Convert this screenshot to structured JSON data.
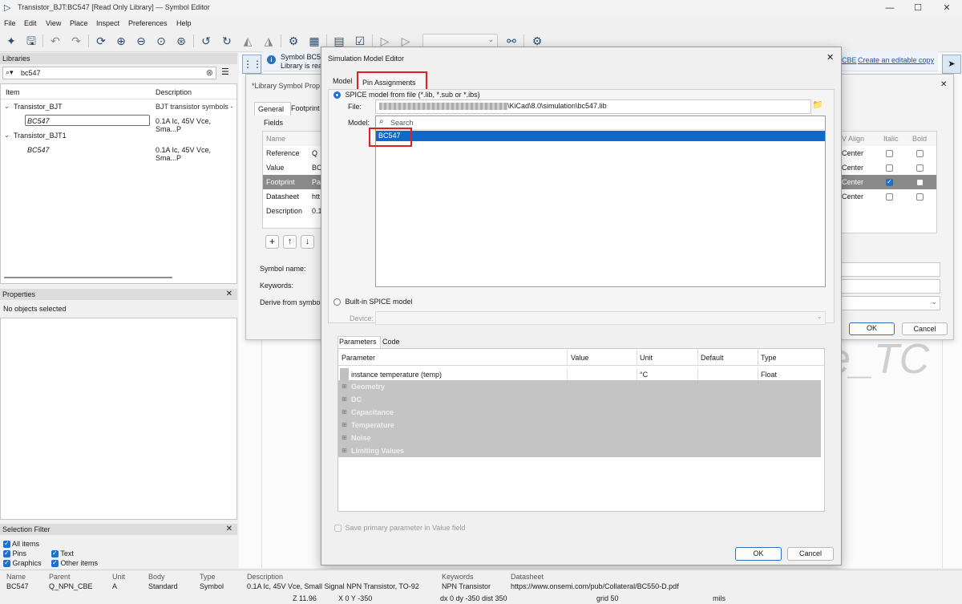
{
  "window": {
    "title": "Transistor_BJT:BC547 [Read Only Library] — Symbol Editor",
    "menu": [
      "File",
      "Edit",
      "View",
      "Place",
      "Inspect",
      "Preferences",
      "Help"
    ]
  },
  "libraries": {
    "header": "Libraries",
    "search_value": "bc547",
    "col_item": "Item",
    "col_description": "Description",
    "rows": [
      {
        "item": "Transistor_BJT",
        "description": "BJT transistor symbols -"
      },
      {
        "item": "BC547",
        "description": "0.1A Ic, 45V Vce, Sma...P"
      },
      {
        "item": "Transistor_BJT1",
        "description": ""
      },
      {
        "item": "BC547",
        "description": "0.1A Ic, 45V Vce, Sma...P"
      }
    ]
  },
  "properties": {
    "header": "Properties",
    "empty_text": "No objects selected"
  },
  "selection_filter": {
    "header": "Selection Filter",
    "items": [
      "All items",
      "Pins",
      "Text",
      "Graphics",
      "Other items"
    ]
  },
  "infobar": {
    "line1": "Symbol BC5",
    "line2": "Library is rea",
    "link1": "CBE",
    "link2": "Create an editable copy"
  },
  "lib_props": {
    "title": "*Library Symbol Prop",
    "tab_general": "General",
    "tab_footprint": "Footprint",
    "fields_label": "Fields",
    "rows": [
      {
        "name": "Name",
        "value": ""
      },
      {
        "name": "Reference",
        "value": "Q"
      },
      {
        "name": "Value",
        "value": "BC"
      },
      {
        "name": "Footprint",
        "value": "Pa"
      },
      {
        "name": "Datasheet",
        "value": "htt"
      },
      {
        "name": "Description",
        "value": "0.1"
      }
    ],
    "symbol_name_label": "Symbol name:",
    "keywords_label": "Keywords:",
    "derive_label": "Derive from symbo",
    "right_cols": [
      "V Align",
      "Italic",
      "Bold"
    ],
    "right_rows": [
      "Center",
      "Center",
      "Center",
      "Center"
    ],
    "ok": "OK",
    "cancel": "Cancel"
  },
  "sim_dialog": {
    "title": "Simulation Model Editor",
    "tab_model": "Model",
    "tab_pins": "Pin Assignments",
    "spice_file_radio": "SPICE model from file (*.lib, *.sub or *.ibs)",
    "file_label": "File:",
    "file_value": "\\KiCad\\8.0\\simulation\\bc547.lib",
    "model_label": "Model:",
    "search_placeholder": "Search",
    "model_selected": "BC547",
    "builtin_radio": "Built-in SPICE model",
    "device_label": "Device:",
    "param_tabs": [
      "Parameters",
      "Code"
    ],
    "param_columns": [
      "Parameter",
      "Value",
      "Unit",
      "Default",
      "Type"
    ],
    "first_param": {
      "name": "instance temperature (temp)",
      "value": "",
      "unit": "°C",
      "default": "",
      "type": "Float"
    },
    "groups": [
      "Geometry",
      "DC",
      "Capacitance",
      "Temperature",
      "Noise",
      "Limiting Values"
    ],
    "save_primary": "Save primary parameter in Value field",
    "ok": "OK",
    "cancel": "Cancel"
  },
  "canvas_text": "e_TC",
  "statusbar": {
    "headers": [
      "Name",
      "Parent",
      "Unit",
      "Body",
      "Type",
      "Description",
      "Keywords",
      "Datasheet"
    ],
    "values": [
      "BC547",
      "Q_NPN_CBE",
      "A",
      "Standard",
      "Symbol",
      "0.1A Ic, 45V Vce, Small Signal NPN Transistor, TO-92",
      "NPN Transistor",
      "https://www.onsemi.com/pub/Collateral/BC550-D.pdf"
    ],
    "z": "Z 11.96",
    "xy": "X 0  Y -350",
    "dxdy": "dx 0  dy -350  dist 350",
    "grid": "grid 50",
    "units": "mils"
  }
}
